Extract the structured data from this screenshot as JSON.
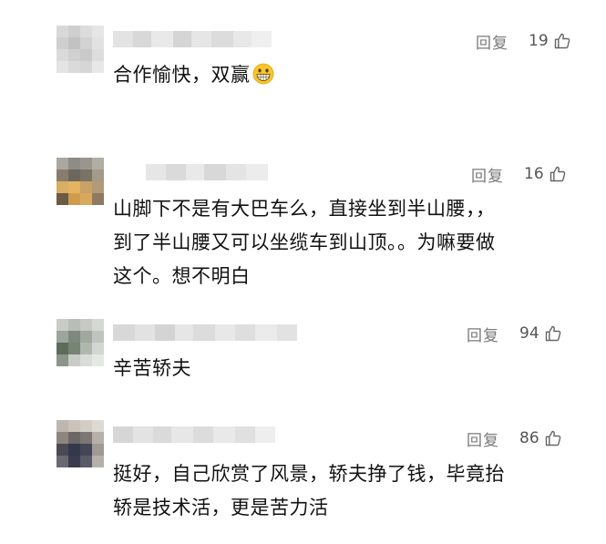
{
  "comments": [
    {
      "reply_label": "回复",
      "likes": "19",
      "lines": [
        "合作愉快，双赢"
      ],
      "emoji": "grinning-face-icon"
    },
    {
      "reply_label": "回复",
      "likes": "16",
      "lines": [
        "山脚下不是有大巴车么，直接坐到半山腰，，",
        "到了半山腰又可以坐缆车到山顶。。为嘛要做",
        "这个。想不明白"
      ]
    },
    {
      "reply_label": "回复",
      "likes": "94",
      "lines": [
        "辛苦轿夫"
      ]
    },
    {
      "reply_label": "回复",
      "likes": "86",
      "lines": [
        "挺好，自己欣赏了风景，轿夫挣了钱，毕竟抬",
        "轿是技术活，更是苦力活"
      ]
    }
  ],
  "colors": {
    "meta_text": "#7a7a7a",
    "body_text": "#111111",
    "background": "#ffffff"
  }
}
